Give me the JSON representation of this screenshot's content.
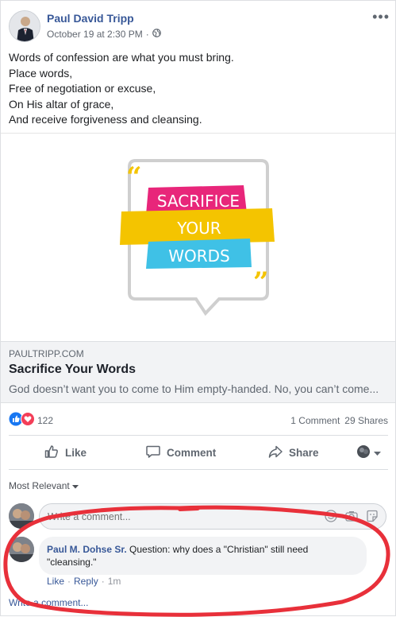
{
  "post": {
    "author": "Paul David Tripp",
    "timestamp": "October 19 at 2:30 PM",
    "separator": "·",
    "lines": [
      "Words of confession are what you must bring.",
      "Place words,",
      "Free of negotiation or excuse,",
      "On His altar of grace,",
      "And receive forgiveness and cleansing."
    ]
  },
  "image": {
    "line1": "SACRIFICE",
    "line2": "YOUR",
    "line3": "WORDS",
    "colors": {
      "pink": "#e8267a",
      "yellow": "#f4c400",
      "cyan": "#3fc1e6"
    }
  },
  "link": {
    "domain": "PAULTRIPP.COM",
    "title": "Sacrifice Your Words",
    "description": "God doesn’t want you to come to Him empty-handed. No, you can’t come..."
  },
  "stats": {
    "reactions": "122",
    "comments": "1 Comment",
    "shares": "29 Shares"
  },
  "actions": {
    "like": "Like",
    "comment": "Comment",
    "share": "Share"
  },
  "comments": {
    "sort": "Most Relevant",
    "placeholder": "Write a comment...",
    "items": [
      {
        "author": "Paul M. Dohse Sr.",
        "text": "Question: why does a \"Christian\" still need \"cleansing.\"",
        "like": "Like",
        "reply": "Reply",
        "dot": "·",
        "time": "1m"
      }
    ],
    "write_link": "Write a comment..."
  },
  "colors": {
    "link_blue": "#385898",
    "like_blue": "#1877f2",
    "love_red": "#f33e58",
    "annotation_red": "#e8303a"
  }
}
